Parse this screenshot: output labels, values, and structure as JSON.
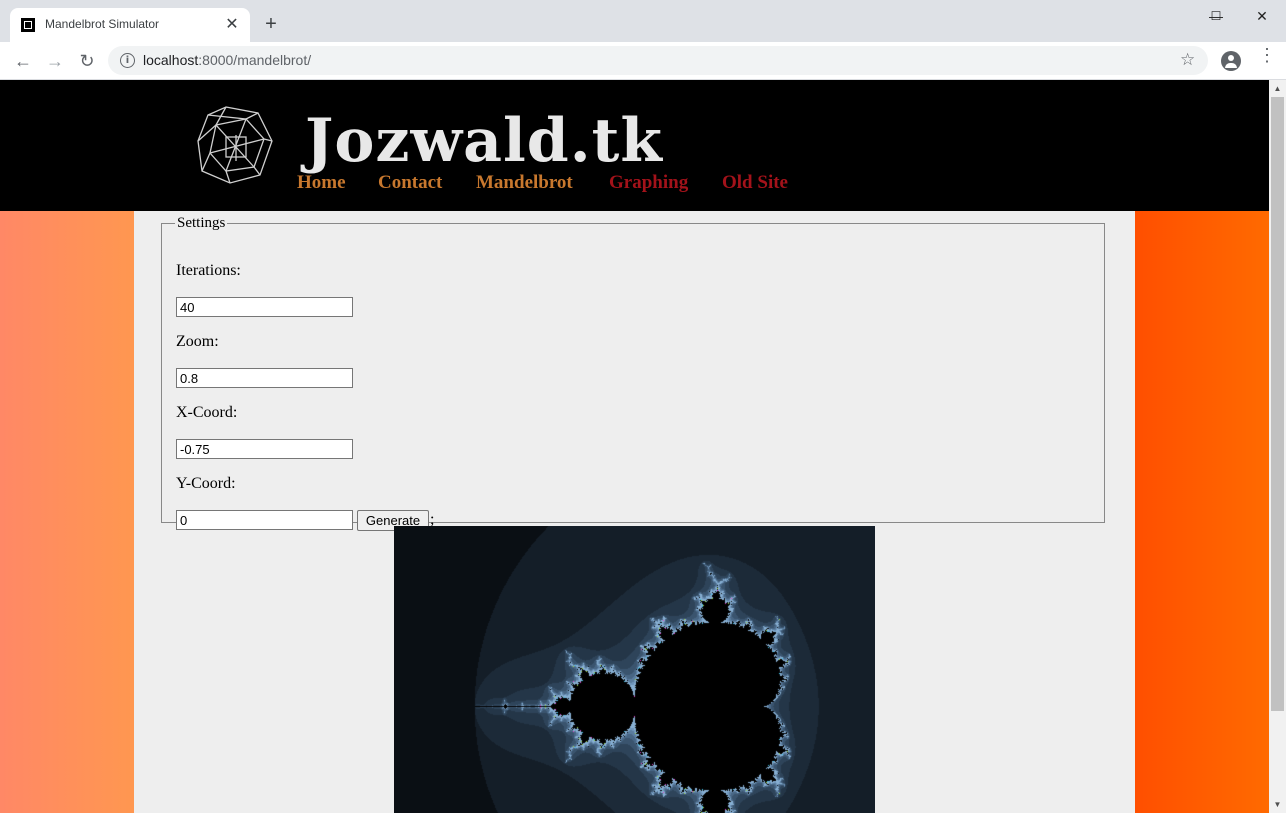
{
  "browser": {
    "tab_title": "Mandelbrot Simulator",
    "tab_close": "✕",
    "new_tab": "+",
    "url_host": "localhost",
    "url_rest": ":8000/mandelbrot/",
    "window_controls": {
      "minimize": "—",
      "maximize": "☐",
      "close": "✕"
    }
  },
  "site": {
    "title": "Jozwald.tk",
    "nav": [
      {
        "label": "Home",
        "color": "#c8782e"
      },
      {
        "label": "Contact",
        "color": "#c8782e"
      },
      {
        "label": "Mandelbrot",
        "color": "#c8782e"
      },
      {
        "label": "Graphing",
        "color": "#a3121a"
      },
      {
        "label": "Old Site",
        "color": "#a3121a"
      }
    ]
  },
  "settings": {
    "legend": "Settings",
    "iterations": {
      "label": "Iterations:",
      "value": "40"
    },
    "zoom": {
      "label": "Zoom:",
      "value": "0.8"
    },
    "x_coord": {
      "label": "X-Coord:",
      "value": "-0.75"
    },
    "y_coord": {
      "label": "Y-Coord:",
      "value": "0"
    },
    "generate_label": "Generate",
    "trailing_text": ";"
  }
}
